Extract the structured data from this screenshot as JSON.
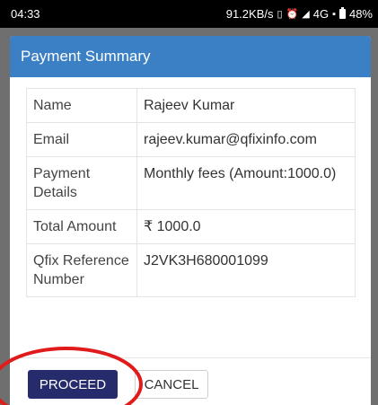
{
  "status_bar": {
    "time": "04:33",
    "network_speed": "91.2KB/s",
    "signal": "4G",
    "battery": "48%",
    "icons": [
      "vibrate-icon",
      "alarm-icon",
      "signal-icon",
      "volte-icon",
      "battery-icon"
    ]
  },
  "modal": {
    "title": "Payment Summary",
    "rows": [
      {
        "label": "Name",
        "value": "Rajeev Kumar"
      },
      {
        "label": "Email",
        "value": "rajeev.kumar@qfixinfo.com"
      },
      {
        "label": "Payment Details",
        "value": "Monthly fees (Amount:1000.0)"
      },
      {
        "label": "Total Amount",
        "value": "₹ 1000.0"
      },
      {
        "label": "Qfix Reference Number",
        "value": "J2VK3H680001099"
      }
    ],
    "proceed_label": "PROCEED",
    "cancel_label": "CANCEL"
  },
  "colors": {
    "header": "#3b7fc4",
    "proceed_button": "#262b6b",
    "annotation": "#e01b1b",
    "overlay": "#6f6f6f"
  }
}
